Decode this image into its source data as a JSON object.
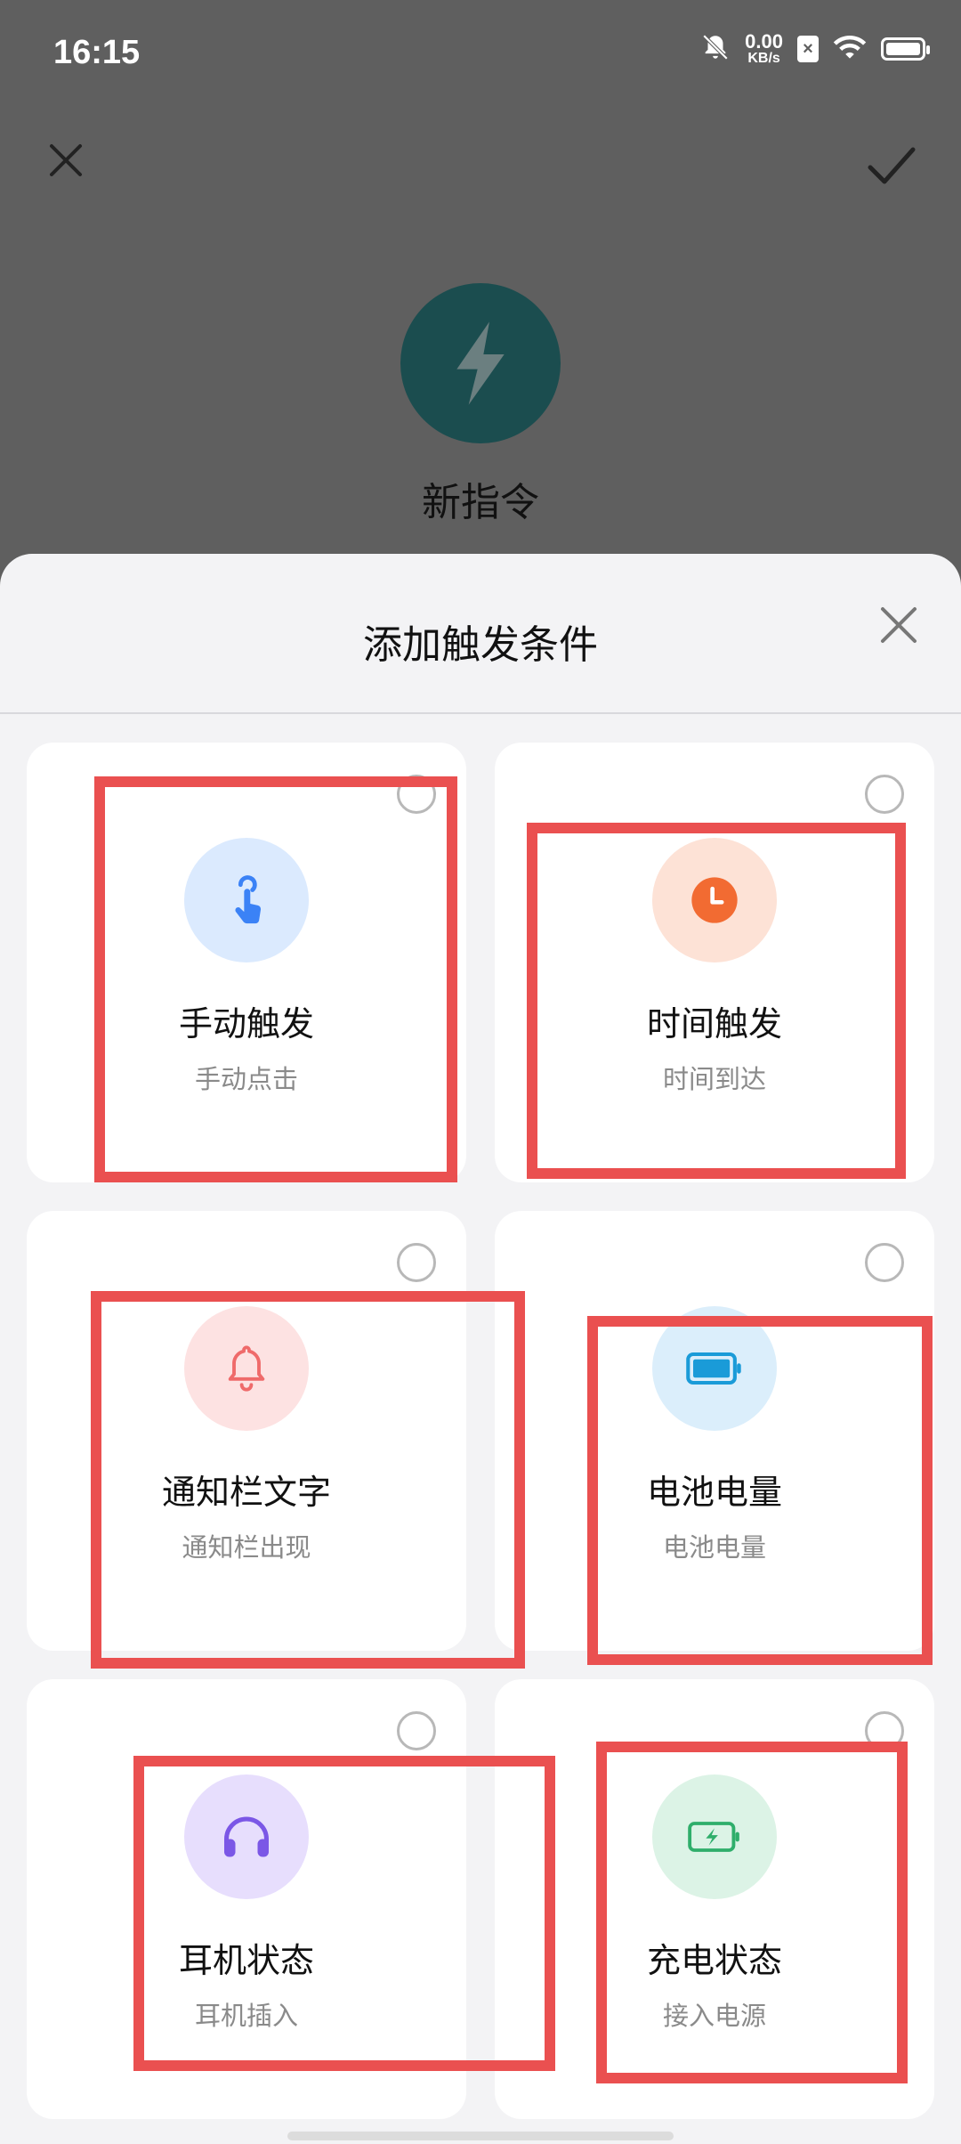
{
  "status_bar": {
    "time": "16:15",
    "net_speed": "0.00",
    "net_unit": "KB/s",
    "sim_label": "×",
    "icons": [
      "mute-bell-icon",
      "wifi-icon",
      "battery-icon"
    ]
  },
  "header": {
    "close_icon": "close-icon",
    "confirm_icon": "check-icon",
    "command_icon": "lightning-icon",
    "command_title": "新指令",
    "avatar_color": "#1b4d4f"
  },
  "sheet": {
    "title": "添加触发条件",
    "close_icon": "close-icon",
    "cards": [
      {
        "label": "手动触发",
        "sublabel": "手动点击",
        "icon": "tap-hand-icon",
        "bg": "#dbeafe",
        "color": "#3b82f6"
      },
      {
        "label": "时间触发",
        "sublabel": "时间到达",
        "icon": "clock-icon",
        "bg": "#fde2d6",
        "color": "#f26b32"
      },
      {
        "label": "通知栏文字",
        "sublabel": "通知栏出现",
        "icon": "bell-icon",
        "bg": "#fde2e2",
        "color": "#ef6a6a"
      },
      {
        "label": "电池电量",
        "sublabel": "电池电量",
        "icon": "battery-level-icon",
        "bg": "#dbeefb",
        "color": "#1a9bd8"
      },
      {
        "label": "耳机状态",
        "sublabel": "耳机插入",
        "icon": "headphones-icon",
        "bg": "#e7defd",
        "color": "#7b57e6"
      },
      {
        "label": "充电状态",
        "sublabel": "接入电源",
        "icon": "charging-icon",
        "bg": "#dcf3e6",
        "color": "#2fae6b"
      }
    ]
  },
  "highlight_color": "#ea5050"
}
